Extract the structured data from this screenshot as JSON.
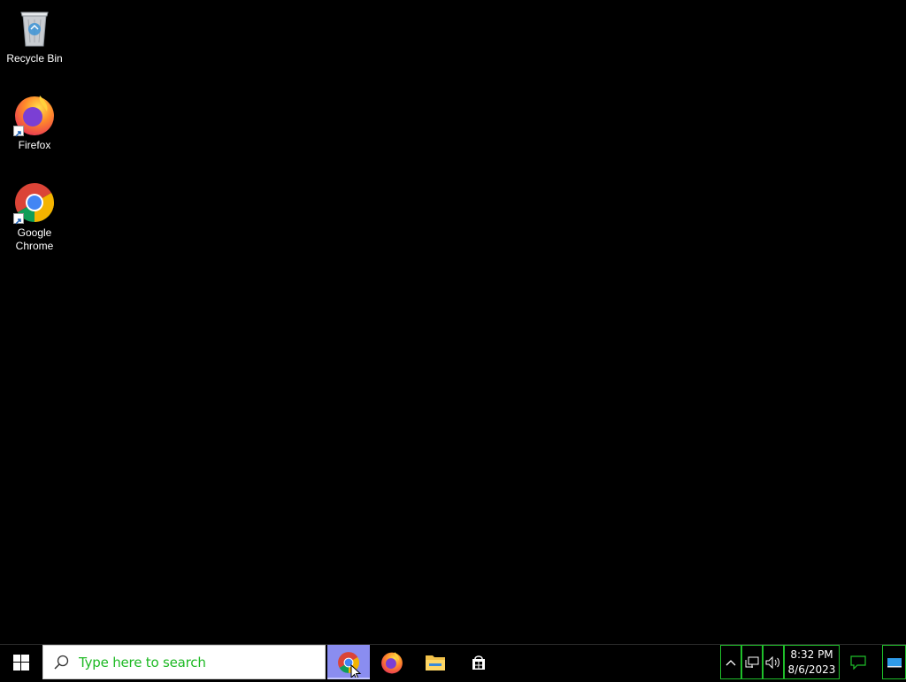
{
  "desktop": {
    "icons": [
      {
        "label": "Recycle Bin"
      },
      {
        "label": "Firefox"
      },
      {
        "label": "Google Chrome"
      }
    ]
  },
  "taskbar": {
    "search": {
      "placeholder": "Type here to search"
    },
    "pinned": [
      {
        "name": "Google Chrome",
        "active": true
      },
      {
        "name": "Firefox",
        "active": false
      },
      {
        "name": "File Explorer",
        "active": false
      },
      {
        "name": "Microsoft Store",
        "active": false
      }
    ],
    "clock": {
      "time": "8:32 PM",
      "date": "8/6/2023"
    }
  },
  "colors": {
    "desktop_bg": "#000000",
    "search_text": "#1db923",
    "active_app_bg": "#8a8df0",
    "tray_outline": "#1fbf2a"
  }
}
